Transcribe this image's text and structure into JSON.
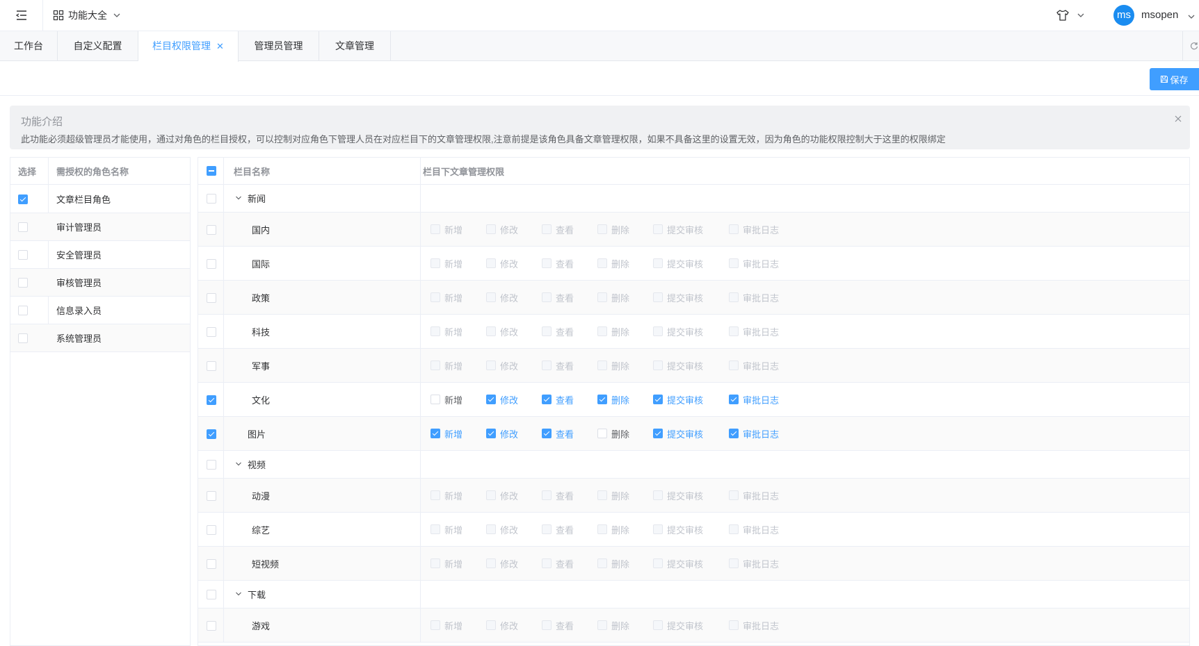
{
  "header": {
    "menu_icon": "menu-fold-icon",
    "func_menu_label": "功能大全",
    "theme_icon": "shirt-icon",
    "avatar_text": "ms",
    "username": "msopen"
  },
  "tabs": [
    {
      "label": "工作台",
      "active": false
    },
    {
      "label": "自定义配置",
      "active": false
    },
    {
      "label": "栏目权限管理",
      "active": true
    },
    {
      "label": "管理员管理",
      "active": false
    },
    {
      "label": "文章管理",
      "active": false
    }
  ],
  "toolbar": {
    "save_label": "保存"
  },
  "notice": {
    "title": "功能介绍",
    "description": "此功能必须超级管理员才能使用，通过对角色的栏目授权，可以控制对应角色下管理人员在对应栏目下的文章管理权限,注意前提是该角色具备文章管理权限，如果不具备这里的设置无效，因为角色的功能权限控制大于这里的权限绑定"
  },
  "role_table": {
    "headers": {
      "select": "选择",
      "name": "需授权的角色名称"
    },
    "rows": [
      {
        "name": "文章栏目角色",
        "checked": true
      },
      {
        "name": "审计管理员",
        "checked": false
      },
      {
        "name": "安全管理员",
        "checked": false
      },
      {
        "name": "审核管理员",
        "checked": false
      },
      {
        "name": "信息录入员",
        "checked": false
      },
      {
        "name": "系统管理员",
        "checked": false
      }
    ]
  },
  "perm_table": {
    "headers": {
      "name": "栏目名称",
      "perms": "栏目下文章管理权限"
    },
    "header_checkbox": "indeterminate",
    "perm_labels": [
      "新增",
      "修改",
      "查看",
      "删除",
      "提交审核",
      "审批日志"
    ],
    "rows": [
      {
        "name": "新闻",
        "type": "group",
        "checked": false
      },
      {
        "name": "国内",
        "type": "child",
        "checked": false,
        "perms": [
          false,
          false,
          false,
          false,
          false,
          false
        ]
      },
      {
        "name": "国际",
        "type": "child",
        "checked": false,
        "perms": [
          false,
          false,
          false,
          false,
          false,
          false
        ]
      },
      {
        "name": "政策",
        "type": "child",
        "checked": false,
        "perms": [
          false,
          false,
          false,
          false,
          false,
          false
        ]
      },
      {
        "name": "科技",
        "type": "child",
        "checked": false,
        "perms": [
          false,
          false,
          false,
          false,
          false,
          false
        ]
      },
      {
        "name": "军事",
        "type": "child",
        "checked": false,
        "perms": [
          false,
          false,
          false,
          false,
          false,
          false
        ]
      },
      {
        "name": "文化",
        "type": "child",
        "checked": true,
        "perms": [
          false,
          true,
          true,
          true,
          true,
          true
        ]
      },
      {
        "name": "图片",
        "type": "leaf",
        "checked": true,
        "perms": [
          true,
          true,
          true,
          false,
          true,
          true
        ]
      },
      {
        "name": "视频",
        "type": "group",
        "checked": false
      },
      {
        "name": "动漫",
        "type": "child",
        "checked": false,
        "perms": [
          false,
          false,
          false,
          false,
          false,
          false
        ]
      },
      {
        "name": "综艺",
        "type": "child",
        "checked": false,
        "perms": [
          false,
          false,
          false,
          false,
          false,
          false
        ]
      },
      {
        "name": "短视频",
        "type": "child",
        "checked": false,
        "perms": [
          false,
          false,
          false,
          false,
          false,
          false
        ]
      },
      {
        "name": "下载",
        "type": "group",
        "checked": false
      },
      {
        "name": "游戏",
        "type": "child",
        "checked": false,
        "perms": [
          false,
          false,
          false,
          false,
          false,
          false
        ]
      }
    ]
  },
  "colors": {
    "primary": "#409eff",
    "avatar": "#1a8cf0",
    "border": "#ebeef5"
  }
}
